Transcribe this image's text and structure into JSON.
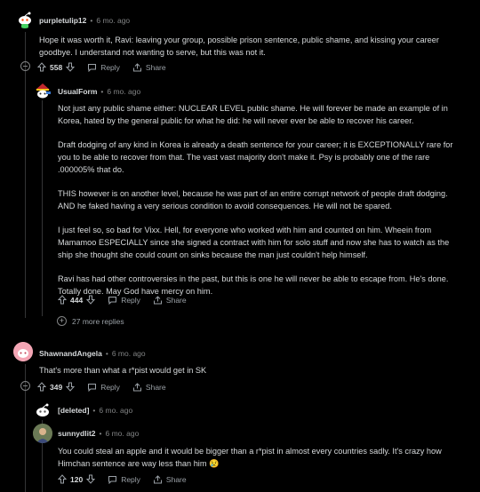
{
  "comments": [
    {
      "author": "purpletulip12",
      "age": "6 mo. ago",
      "body": [
        "Hope it was worth it, Ravi: leaving your group, possible prison sentence, public shame, and kissing your career goodbye. I understand not wanting to serve, but this was not it."
      ],
      "votes": "558",
      "reply_label": "Reply",
      "share_label": "Share"
    },
    {
      "author": "UsualForm",
      "age": "6 mo. ago",
      "body": [
        "Not just any public shame either: NUCLEAR LEVEL public shame. He will forever be made an example of in Korea, hated by the general public for what he did: he will never ever be able to recover his career.",
        "Draft dodging of any kind in Korea is already a death sentence for your career; it is EXCEPTIONALLY rare for you to be able to recover from that. The vast vast majority don't make it. Psy is probably one of the rare .000005% that do.",
        "THIS however is on another level, because he was part of an entire corrupt network of people draft dodging. AND he faked having a very serious condition to avoid consequences. He will not be spared.",
        "I just feel so, so bad for Vixx. Hell, for everyone who worked with him and counted on him. Wheein from Mamamoo ESPECIALLY since she signed a contract with him for solo stuff and now she has to watch as the ship she thought she could count on sinks because the man just couldn't help himself.",
        "Ravi has had other controversies in the past, but this is one he will never be able to escape from. He's done. Totally done. May God have mercy on him."
      ],
      "votes": "444",
      "reply_label": "Reply",
      "share_label": "Share"
    },
    {
      "author": "ShawnandAngela",
      "age": "6 mo. ago",
      "body": [
        "That's more than what a r*pist would get in SK"
      ],
      "votes": "349",
      "reply_label": "Reply",
      "share_label": "Share"
    },
    {
      "author": "[deleted]",
      "age": "6 mo. ago"
    },
    {
      "author": "sunnydlit2",
      "age": "6 mo. ago",
      "body": [
        "You could steal an apple and it would be bigger than a r*pist in almost every countries sadly. It's crazy how Himchan sentence are way less than him 😢"
      ],
      "votes": "120",
      "reply_label": "Reply",
      "share_label": "Share"
    }
  ],
  "more_replies": "27 more replies",
  "colors": {
    "background": "#000000",
    "text": "#d7dadc",
    "muted": "#818384",
    "thread_line": "#343536"
  }
}
